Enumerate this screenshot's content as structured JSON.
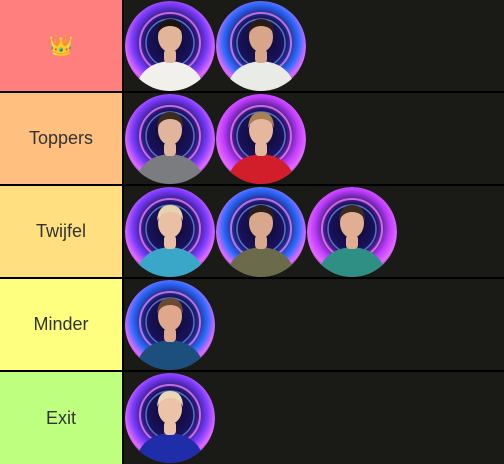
{
  "tiers": [
    {
      "label": "👑",
      "color": "#ff7f7f",
      "items": [
        {
          "skin": "#e2b49a",
          "hair": "#1c1410",
          "shirt": "#f2f0ec",
          "ring": "#7d3cff"
        },
        {
          "skin": "#d9a58a",
          "hair": "#2a1c14",
          "shirt": "#e9ebe6",
          "ring": "#2d6bff"
        }
      ]
    },
    {
      "label": "Toppers",
      "color": "#ffbf7f",
      "items": [
        {
          "skin": "#e0b59c",
          "hair": "#3b2a1e",
          "shirt": "#7a7c80",
          "ring": "#7d3cff"
        },
        {
          "skin": "#e6b79d",
          "hair": "#a88052",
          "shirt": "#d11e2a",
          "ring": "#c23cff"
        }
      ]
    },
    {
      "label": "Twijfel",
      "color": "#ffdf7f",
      "items": [
        {
          "skin": "#eac0a4",
          "hair": "#e5d3ad",
          "shirt": "#3aa6c8",
          "ring": "#7d3cff"
        },
        {
          "skin": "#d9a88c",
          "hair": "#2a1f18",
          "shirt": "#6b6a4a",
          "ring": "#2d6bff"
        },
        {
          "skin": "#e2ae93",
          "hair": "#3b2a1f",
          "shirt": "#2f8f84",
          "ring": "#c23cff"
        }
      ]
    },
    {
      "label": "Minder",
      "color": "#ffff7f",
      "items": [
        {
          "skin": "#dfa88d",
          "hair": "#6b4a33",
          "shirt": "#1d4f7d",
          "ring": "#2d6bff"
        }
      ]
    },
    {
      "label": "Exit",
      "color": "#bfff7f",
      "items": [
        {
          "skin": "#ecc3a8",
          "hair": "#e8d8b6",
          "shirt": "#1f2ea8",
          "ring": "#7d3cff"
        }
      ]
    }
  ]
}
